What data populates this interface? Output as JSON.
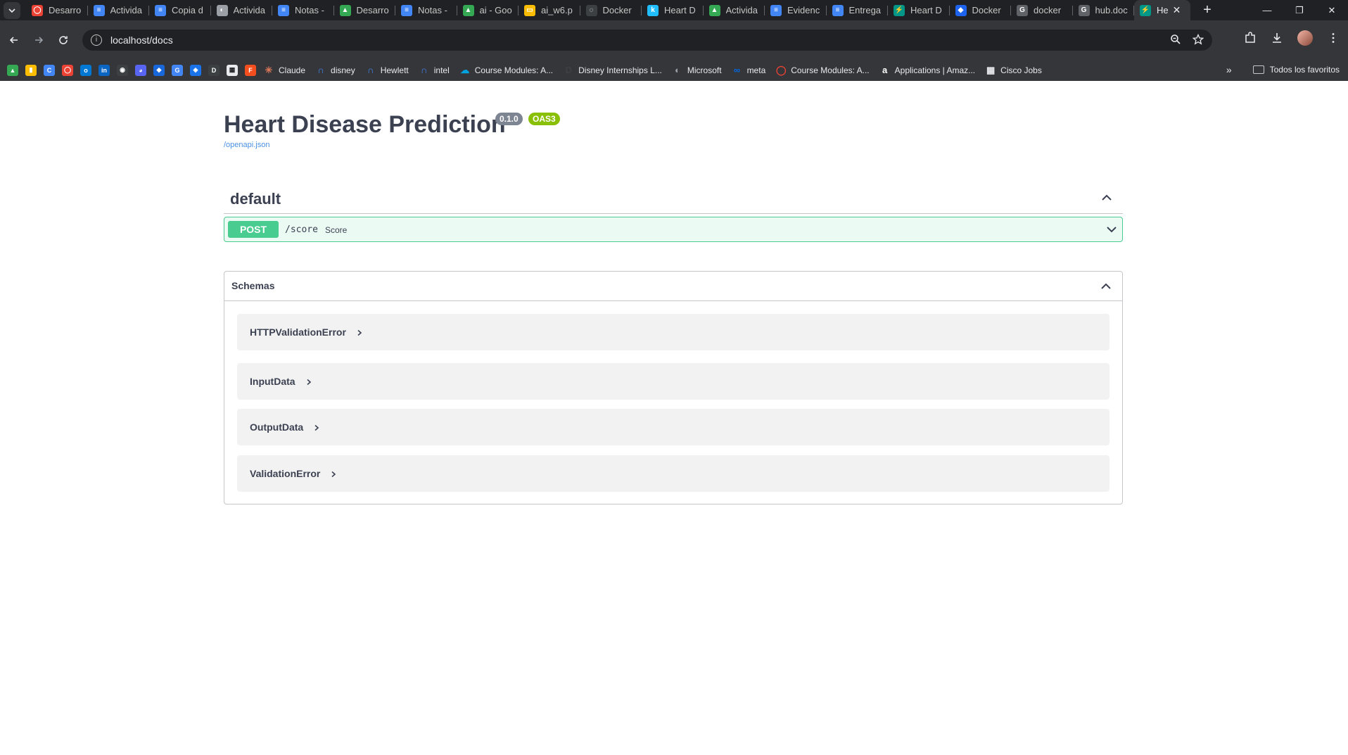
{
  "browser": {
    "tabs": [
      {
        "label": "Desarro",
        "color": "#ea4335",
        "glyph": "◯"
      },
      {
        "label": "Activida",
        "color": "#4285f4",
        "glyph": "≡"
      },
      {
        "label": "Copia d",
        "color": "#4285f4",
        "glyph": "≡"
      },
      {
        "label": "Activida",
        "color": "#9aa0a6",
        "glyph": "◐"
      },
      {
        "label": "Notas -",
        "color": "#4285f4",
        "glyph": "≡"
      },
      {
        "label": "Desarro",
        "color": "#34a853",
        "glyph": "▲"
      },
      {
        "label": "Notas -",
        "color": "#4285f4",
        "glyph": "≡"
      },
      {
        "label": "ai - Goo",
        "color": "#34a853",
        "glyph": "▲"
      },
      {
        "label": "ai_w6.p",
        "color": "#fbbc04",
        "glyph": "▭"
      },
      {
        "label": "Docker",
        "color": "#3c4043",
        "glyph": "◌"
      },
      {
        "label": "Heart D",
        "color": "#20beff",
        "glyph": "k"
      },
      {
        "label": "Activida",
        "color": "#34a853",
        "glyph": "▲"
      },
      {
        "label": "Evidenc",
        "color": "#4285f4",
        "glyph": "≡"
      },
      {
        "label": "Entrega",
        "color": "#4285f4",
        "glyph": "≡"
      },
      {
        "label": "Heart D",
        "color": "#009688",
        "glyph": "⚡"
      },
      {
        "label": "Docker",
        "color": "#1d63ed",
        "glyph": "◆"
      },
      {
        "label": "docker",
        "color": "#5f6368",
        "glyph": "G"
      },
      {
        "label": "hub.doc",
        "color": "#5f6368",
        "glyph": "G"
      }
    ],
    "active_tab": {
      "label": "He",
      "color": "#009688",
      "glyph": "⚡",
      "close": "✕"
    },
    "new_tab": "+",
    "window_controls": {
      "minimize": "—",
      "restore": "❐",
      "close": "✕"
    },
    "url": "localhost/docs",
    "bookmarks_icons": [
      {
        "color": "#34a853",
        "glyph": "▲"
      },
      {
        "color": "#fbbc04",
        "glyph": "▮"
      },
      {
        "color": "#4285f4",
        "glyph": "C"
      },
      {
        "color": "#ea4335",
        "glyph": "◯"
      },
      {
        "color": "#0078d4",
        "glyph": "o"
      },
      {
        "color": "#0a66c2",
        "glyph": "in"
      },
      {
        "color": "#3c4043",
        "glyph": "◉"
      },
      {
        "color": "#5865f2",
        "glyph": "◕"
      },
      {
        "color": "#1868db",
        "glyph": "◆"
      },
      {
        "color": "#4285f4",
        "glyph": "G"
      },
      {
        "color": "#1a73e8",
        "glyph": "◈"
      },
      {
        "color": "#3c4043",
        "glyph": "D"
      },
      {
        "color": "#e8eaed",
        "glyph": "▦"
      },
      {
        "color": "#f24e1e",
        "glyph": "F"
      }
    ],
    "bookmarks": [
      {
        "label": "Claude",
        "color": "#d97757",
        "glyph": "✳"
      },
      {
        "label": "disney",
        "color": "#4285f4",
        "glyph": "∩"
      },
      {
        "label": "Hewlett",
        "color": "#4285f4",
        "glyph": "∩"
      },
      {
        "label": "intel",
        "color": "#4285f4",
        "glyph": "∩"
      },
      {
        "label": "Course Modules: A...",
        "color": "#00a1e0",
        "glyph": "☁"
      },
      {
        "label": "Disney Internships L...",
        "color": "#3c4043",
        "glyph": "D"
      },
      {
        "label": "Microsoft",
        "color": "#9aa0a6",
        "glyph": "◐"
      },
      {
        "label": "meta",
        "color": "#0668e1",
        "glyph": "∞"
      },
      {
        "label": "Course Modules: A...",
        "color": "#ea4335",
        "glyph": "◯"
      },
      {
        "label": "Applications | Amaz...",
        "color": "#ffffff",
        "glyph": "a"
      },
      {
        "label": "Cisco Jobs",
        "color": "#e8eaed",
        "glyph": "▦"
      }
    ],
    "more_bookmarks": "»",
    "all_bookmarks": "Todos los favoritos"
  },
  "api": {
    "title": "Heart Disease Prediction",
    "version": "0.1.0",
    "oas": "OAS3",
    "spec_link": "/openapi.json"
  },
  "tag": {
    "name": "default"
  },
  "operations": [
    {
      "method": "POST",
      "path": "/score",
      "summary": "Score",
      "color": "#49cc90"
    }
  ],
  "schemas": {
    "title": "Schemas",
    "models": [
      "HTTPValidationError",
      "InputData",
      "OutputData",
      "ValidationError"
    ]
  }
}
